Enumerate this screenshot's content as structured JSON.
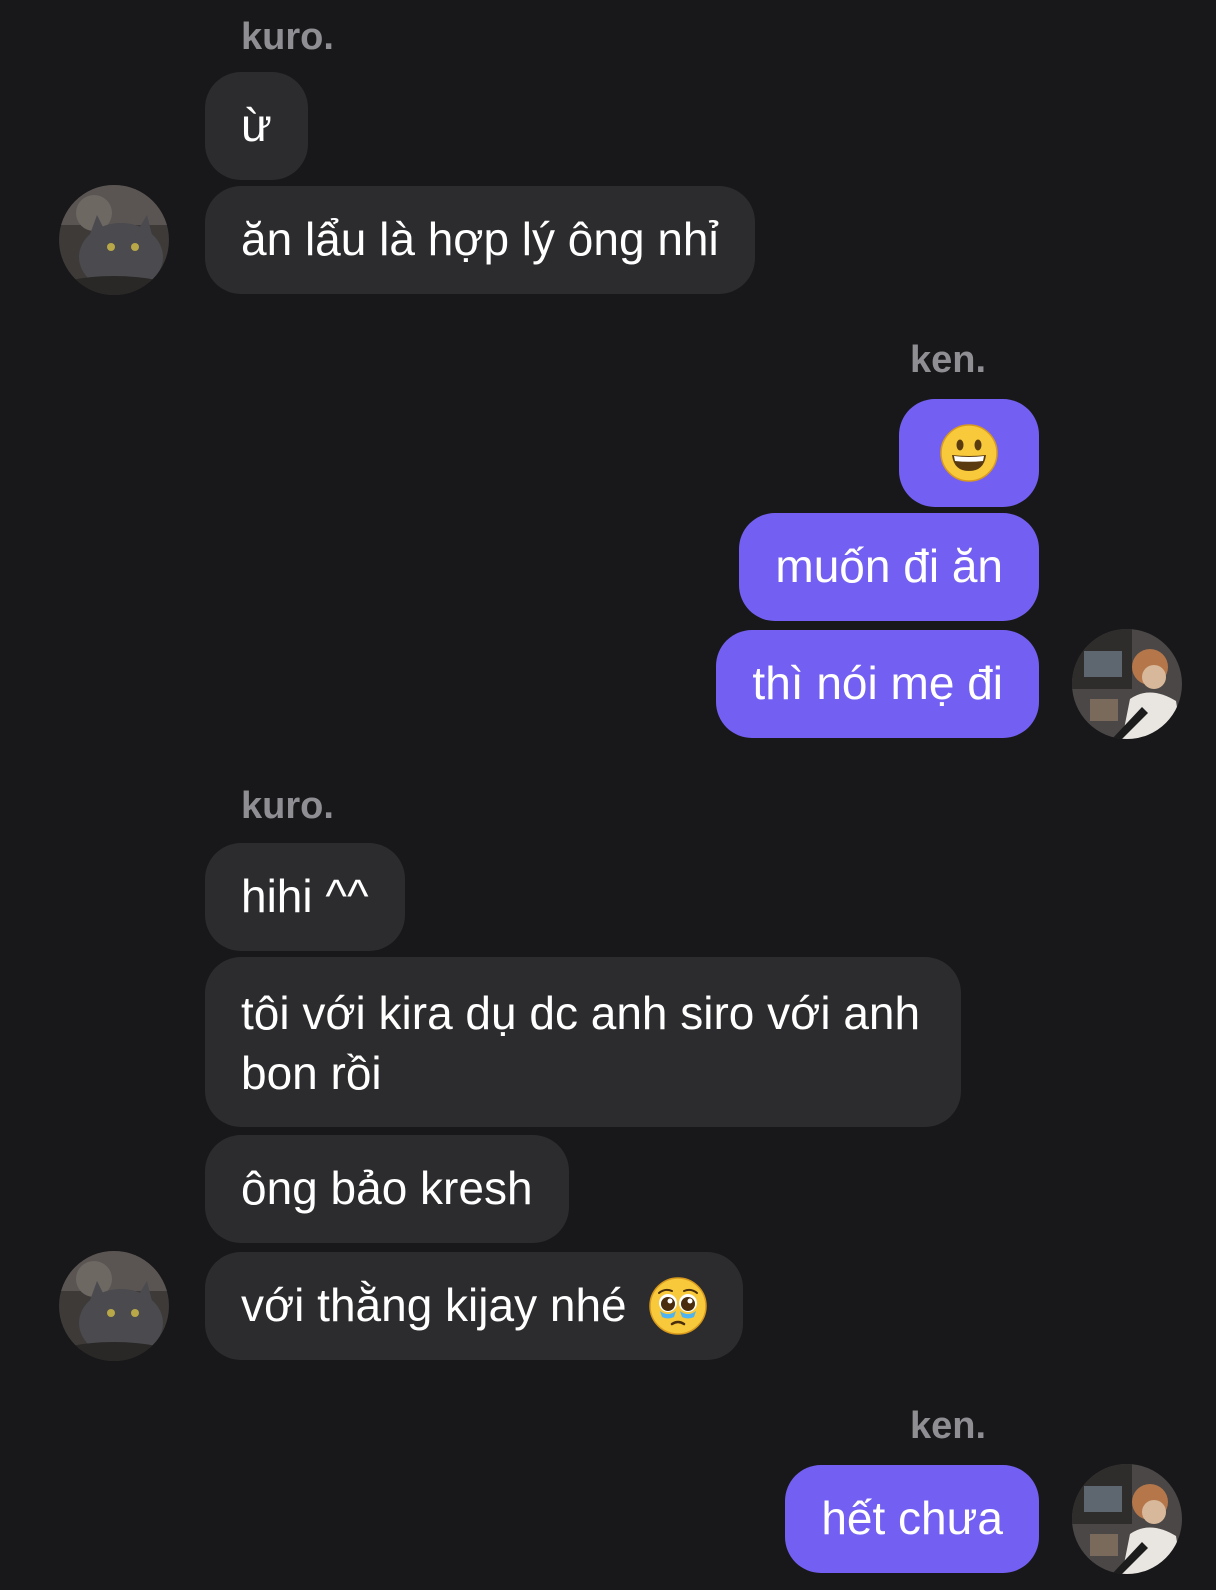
{
  "messages": [
    {
      "sender": "kuro.",
      "text": "ừ"
    },
    {
      "sender": "kuro.",
      "text": "ăn lẩu là hợp lý ông nhỉ"
    },
    {
      "sender": "ken.",
      "emoji": "grinning-face-emoji"
    },
    {
      "sender": "ken.",
      "text": "muốn đi ăn"
    },
    {
      "sender": "ken.",
      "text": "thì nói mẹ đi"
    },
    {
      "sender": "kuro.",
      "text": "hihi ^^"
    },
    {
      "sender": "kuro.",
      "text": "tôi với kira dụ dc anh siro với anh bon rồi"
    },
    {
      "sender": "kuro.",
      "text": "ông bảo kresh"
    },
    {
      "sender": "kuro.",
      "text": "với thằng kijay nhé",
      "emoji": "pleading-face-emoji"
    },
    {
      "sender": "ken.",
      "text": "hết chưa"
    }
  ],
  "groups": {
    "g1": {
      "sender": "kuro."
    },
    "g2": {
      "sender": "ken."
    },
    "g3": {
      "sender": "kuro."
    },
    "g4": {
      "sender": "ken."
    }
  },
  "colors": {
    "background": "#18181a",
    "incoming_bubble": "#2c2c2e",
    "outgoing_bubble": "#7360f2",
    "sender_name": "#8e8e93",
    "text": "#ffffff"
  },
  "icons": {
    "kuro_avatar": "cat-avatar-icon",
    "ken_avatar": "person-avatar-icon"
  }
}
